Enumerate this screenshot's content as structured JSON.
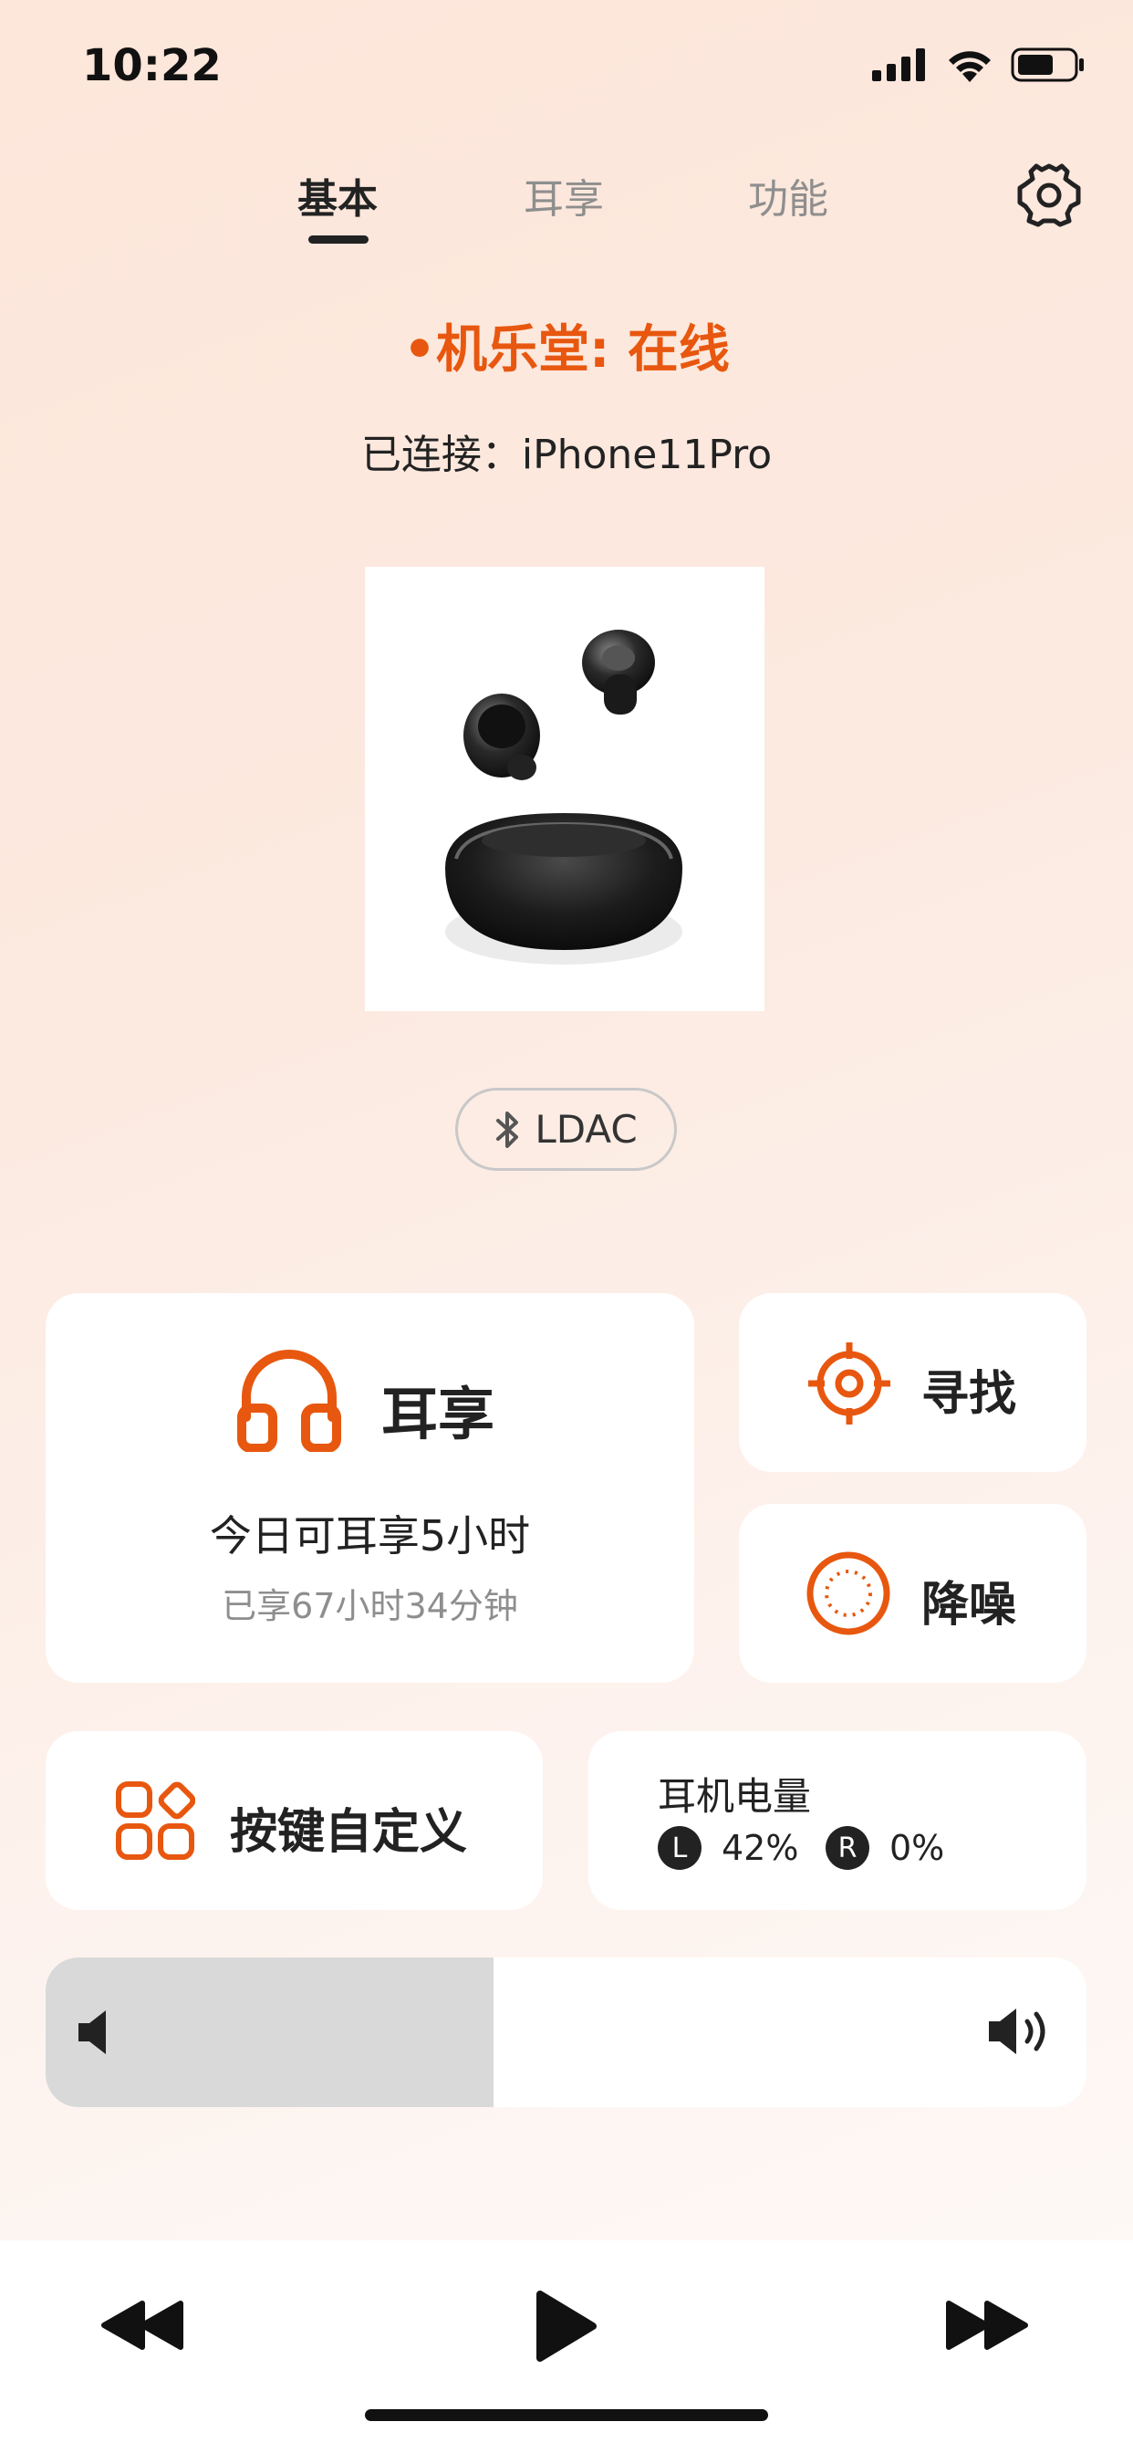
{
  "status_bar": {
    "time": "10:22"
  },
  "tabs": [
    {
      "label": "基本",
      "active": true
    },
    {
      "label": "耳享",
      "active": false
    },
    {
      "label": "功能",
      "active": false
    }
  ],
  "device": {
    "status": "•机乐堂: 在线",
    "connected": "已连接：iPhone11Pro",
    "codec": "LDAC"
  },
  "cards": {
    "erxiang": {
      "title": "耳享",
      "line1": "今日可耳享5小时",
      "line2": "已享67小时34分钟"
    },
    "find": {
      "label": "寻找"
    },
    "anc": {
      "label": "降噪"
    },
    "keys": {
      "label": "按键自定义"
    },
    "battery": {
      "title": "耳机电量",
      "left_badge": "L",
      "left_value": "42%",
      "right_badge": "R",
      "right_value": "0%"
    }
  },
  "volume": {
    "level": 0.43
  },
  "colors": {
    "accent": "#e8570f",
    "text": "#222222",
    "muted": "#8e8e8e"
  },
  "icons": [
    "headphones-icon",
    "target-icon",
    "noise-cancel-icon",
    "grid-icon",
    "bluetooth-icon",
    "speaker-low-icon",
    "speaker-high-icon",
    "rewind-icon",
    "play-icon",
    "fast-forward-icon",
    "gear-icon"
  ]
}
